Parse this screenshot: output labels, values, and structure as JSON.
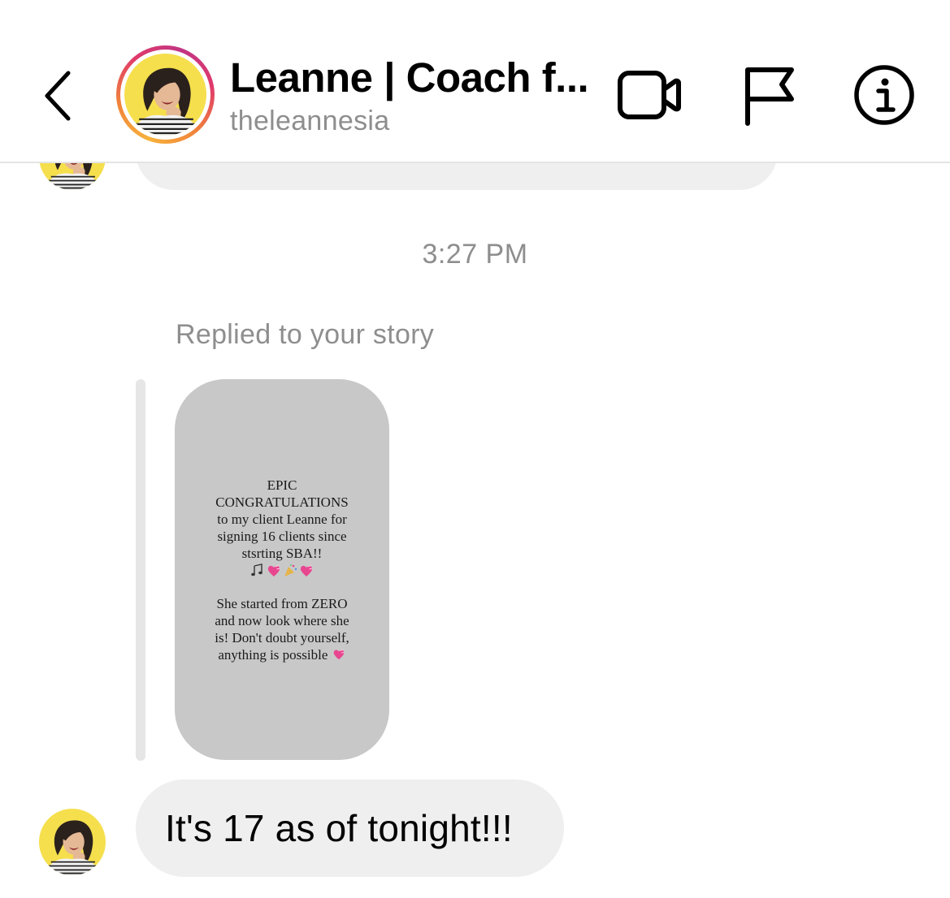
{
  "header": {
    "back_icon": "chevron-left-icon",
    "title": "Leanne | Coach f...",
    "username": "theleannesia",
    "actions": [
      {
        "name": "video-call",
        "icon": "video-camera-icon"
      },
      {
        "name": "report",
        "icon": "flag-icon"
      },
      {
        "name": "info",
        "icon": "info-icon"
      }
    ],
    "story_ring_colors": [
      "#f7b23b",
      "#e03a6b",
      "#c13584"
    ]
  },
  "chat": {
    "timestamp": "3:27 PM",
    "replied_label": "Replied to your story",
    "story": {
      "background": "#c8c8c8",
      "lines_1": [
        "EPIC",
        "CONGRATULATIONS",
        "to my client Leanne for",
        "signing 16 clients since",
        "stsrting SBA!!"
      ],
      "emoji_icons": [
        "music-notes-icon",
        "heart-icon",
        "party-popper-icon",
        "heart-icon"
      ],
      "lines_2": [
        "She started from ZERO",
        "and now look where she",
        "is! Don't doubt yourself,",
        "anything is possible"
      ],
      "end_emoji_icon": "heart-icon"
    },
    "message": "It's 17 as of tonight!!!"
  },
  "colors": {
    "bubble": "#efefef",
    "muted_text": "#8e8e8e",
    "avatar_background": "#f5df4d"
  }
}
